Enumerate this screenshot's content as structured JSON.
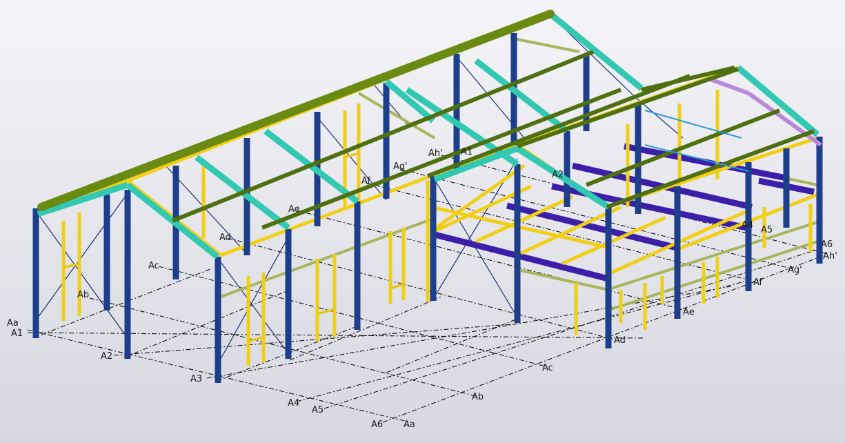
{
  "grid_labels": {
    "Aa": "Aa",
    "A1_left": "A1",
    "Ab": "Ab",
    "A2_left": "A2",
    "Ac": "Ac",
    "A3_left": "A3",
    "Ad": "Ad",
    "A4_left": "A4",
    "A5_left": "A5",
    "A6_left": "A6",
    "Ae": "Ae",
    "Af": "Af",
    "Ag_prime": "Ag'",
    "Ah_prime_top": "Ah'",
    "A1_top": "A1",
    "A2_top": "A2",
    "A4_right": "A4",
    "A5_right": "A5",
    "A6_right": "A6",
    "Ah_prime_right": "Ah'",
    "Ag_prime_right": "Ag'",
    "Af_right": "Af",
    "Ae_right": "Ae",
    "Ad_right": "Ad",
    "Ac_right": "Ac",
    "Ab_right": "Ab",
    "Aa_right": "Aa"
  },
  "colors": {
    "background_top": "#f4f4f8",
    "background_bottom": "#d7d7e0",
    "column": "#1d3e8a",
    "main_rafter": "#6b8a12",
    "purlin": "#4f6f10",
    "teal_rafter": "#32c8b2",
    "secondary_yellow": "#f1cf14",
    "mezzanine_beam": "#3c1fa8",
    "bracing": "#1b2f73",
    "grid": "#111111"
  }
}
